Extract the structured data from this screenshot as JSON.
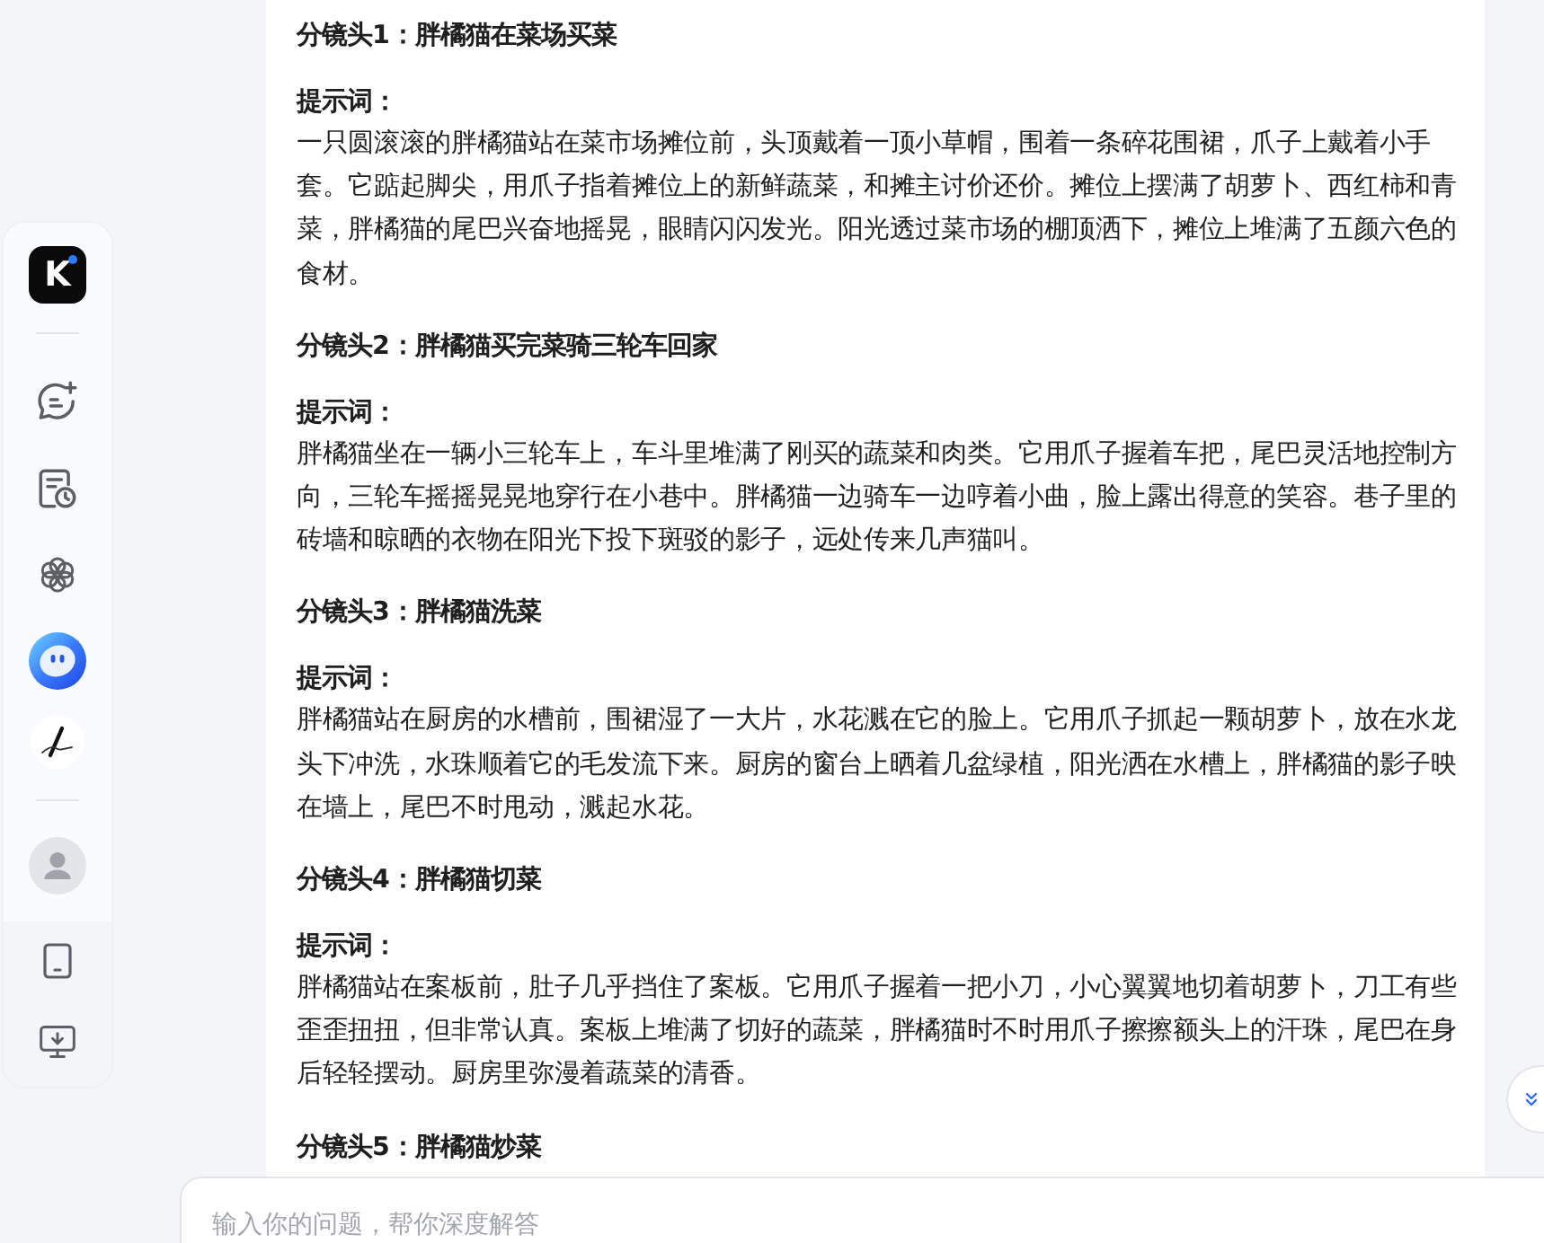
{
  "sidebar": {
    "logo": "K"
  },
  "shots": [
    {
      "title": "分镜头1：胖橘猫在菜场买菜",
      "prompt_label": "提示词：",
      "prompt": "一只圆滚滚的胖橘猫站在菜市场摊位前，头顶戴着一顶小草帽，围着一条碎花围裙，爪子上戴着小手套。它踮起脚尖，用爪子指着摊位上的新鲜蔬菜，和摊主讨价还价。摊位上摆满了胡萝卜、西红柿和青菜，胖橘猫的尾巴兴奋地摇晃，眼睛闪闪发光。阳光透过菜市场的棚顶洒下，摊位上堆满了五颜六色的食材。"
    },
    {
      "title": "分镜头2：胖橘猫买完菜骑三轮车回家",
      "prompt_label": "提示词：",
      "prompt": "胖橘猫坐在一辆小三轮车上，车斗里堆满了刚买的蔬菜和肉类。它用爪子握着车把，尾巴灵活地控制方向，三轮车摇摇晃晃地穿行在小巷中。胖橘猫一边骑车一边哼着小曲，脸上露出得意的笑容。巷子里的砖墙和晾晒的衣物在阳光下投下斑驳的影子，远处传来几声猫叫。"
    },
    {
      "title": "分镜头3：胖橘猫洗菜",
      "prompt_label": "提示词：",
      "prompt": "胖橘猫站在厨房的水槽前，围裙湿了一大片，水花溅在它的脸上。它用爪子抓起一颗胡萝卜，放在水龙头下冲洗，水珠顺着它的毛发流下来。厨房的窗台上晒着几盆绿植，阳光洒在水槽上，胖橘猫的影子映在墙上，尾巴不时甩动，溅起水花。"
    },
    {
      "title": "分镜头4：胖橘猫切菜",
      "prompt_label": "提示词：",
      "prompt": "胖橘猫站在案板前，肚子几乎挡住了案板。它用爪子握着一把小刀，小心翼翼地切着胡萝卜，刀工有些歪歪扭扭，但非常认真。案板上堆满了切好的蔬菜，胖橘猫时不时用爪子擦擦额头上的汗珠，尾巴在身后轻轻摆动。厨房里弥漫着蔬菜的清香。"
    },
    {
      "title": "分镜头5：胖橘猫炒菜"
    }
  ],
  "input": {
    "placeholder": "输入你的问题，帮你深度解答"
  }
}
